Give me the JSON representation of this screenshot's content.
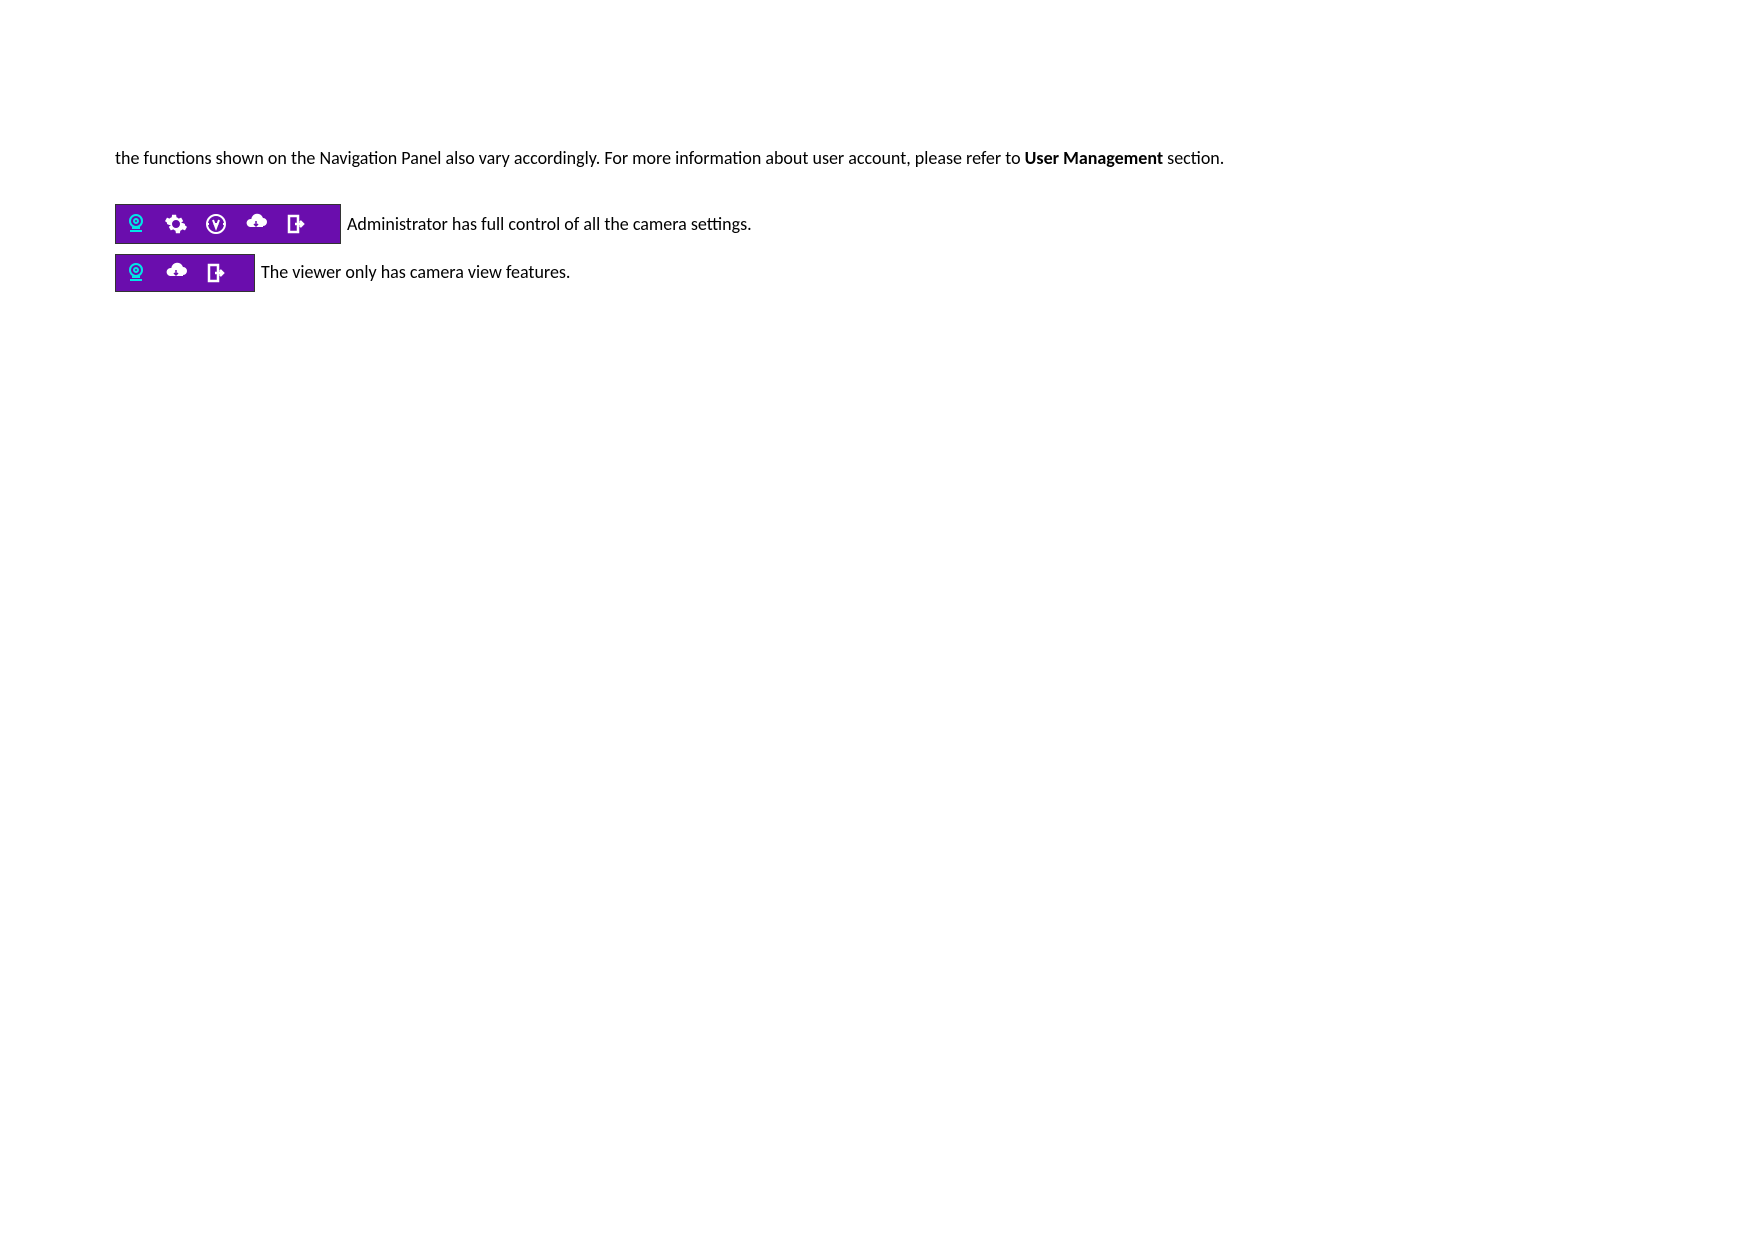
{
  "intro": {
    "part1": "the functions shown on the Navigation Panel also vary accordingly. For more information about user account, please refer to ",
    "bold": "User Management",
    "part2": " section."
  },
  "adminRow": {
    "description": "Administrator has full control of all the camera settings."
  },
  "viewerRow": {
    "description": "The viewer only has camera view features."
  }
}
